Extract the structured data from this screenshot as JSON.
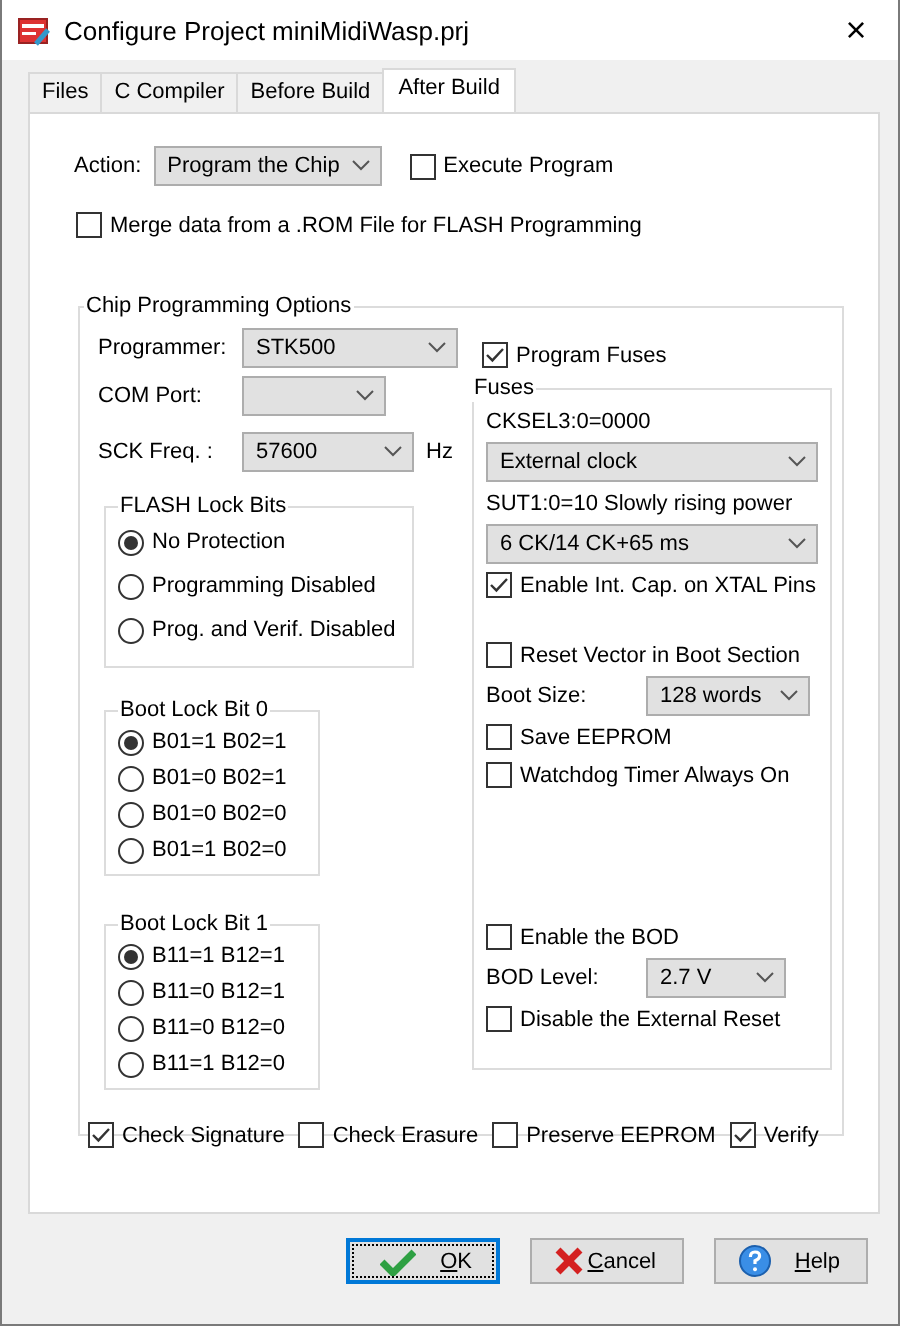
{
  "window": {
    "title": "Configure Project miniMidiWasp.prj",
    "close": "×"
  },
  "tabs": [
    {
      "label": "Files",
      "selected": false
    },
    {
      "label": "C Compiler",
      "selected": false
    },
    {
      "label": "Before Build",
      "selected": false
    },
    {
      "label": "After Build",
      "selected": true
    }
  ],
  "action": {
    "label": "Action:",
    "value": "Program the Chip"
  },
  "execute_program": {
    "label": "Execute Program",
    "checked": false
  },
  "merge_rom": {
    "label": "Merge data from a .ROM File for FLASH Programming",
    "checked": false
  },
  "chip_programming": {
    "title": "Chip Programming Options",
    "programmer": {
      "label": "Programmer:",
      "value": "STK500"
    },
    "com_port": {
      "label": "COM Port:"
    },
    "sck_freq": {
      "label": "SCK Freq. :",
      "value": "57600",
      "unit": "Hz"
    },
    "lock_groups": [
      {
        "title": "FLASH Lock Bits",
        "options": [
          {
            "label": "No Protection",
            "selected": true
          },
          {
            "label": "Programming Disabled",
            "selected": false
          },
          {
            "label": "Prog. and Verif. Disabled",
            "selected": false
          }
        ]
      },
      {
        "title": "Boot Lock Bit 0",
        "options": [
          {
            "label": "B01=1 B02=1",
            "selected": true
          },
          {
            "label": "B01=0 B02=1",
            "selected": false
          },
          {
            "label": "B01=0 B02=0",
            "selected": false
          },
          {
            "label": "B01=1 B02=0",
            "selected": false
          }
        ]
      },
      {
        "title": "Boot Lock Bit 1",
        "options": [
          {
            "label": "B11=1 B12=1",
            "selected": true
          },
          {
            "label": "B11=0 B12=1",
            "selected": false
          },
          {
            "label": "B11=0 B12=0",
            "selected": false
          },
          {
            "label": "B11=1 B12=0",
            "selected": false
          }
        ]
      }
    ],
    "program_fuses": {
      "label": "Program Fuses",
      "checked": true
    },
    "fuses": {
      "title": "Fuses",
      "sections": [
        {
          "items": [
            {
              "kind": "text",
              "label": "CKSEL3:0=0000"
            },
            {
              "kind": "combo",
              "value": "External clock"
            },
            {
              "kind": "text",
              "label": "SUT1:0=10 Slowly rising power"
            },
            {
              "kind": "combo",
              "value": "6 CK/14 CK+65 ms"
            },
            {
              "kind": "checkbox",
              "label": "Enable Int. Cap. on XTAL Pins",
              "checked": true
            }
          ]
        },
        {
          "items": [
            {
              "kind": "checkbox",
              "label": "Reset Vector in Boot Section",
              "checked": false
            },
            {
              "kind": "labeled_combo",
              "label": "Boot Size:",
              "value": "128 words"
            },
            {
              "kind": "checkbox",
              "label": "Save EEPROM",
              "checked": false
            },
            {
              "kind": "checkbox",
              "label": "Watchdog Timer Always On",
              "checked": false
            }
          ]
        },
        {
          "items": [
            {
              "kind": "checkbox",
              "label": "Enable the BOD",
              "checked": false
            },
            {
              "kind": "labeled_combo",
              "label": "BOD Level:",
              "value": "2.7 V"
            },
            {
              "kind": "checkbox",
              "label": "Disable the External Reset",
              "checked": false
            }
          ]
        }
      ]
    },
    "options": [
      {
        "label": "Check Signature",
        "checked": true
      },
      {
        "label": "Check Erasure",
        "checked": false
      },
      {
        "label": "Preserve EEPROM",
        "checked": false
      },
      {
        "label": "Verify",
        "checked": true
      }
    ]
  },
  "buttons": [
    {
      "kind": "ok",
      "label": "OK",
      "focused": true
    },
    {
      "kind": "cancel",
      "label": "Cancel",
      "focused": false
    },
    {
      "kind": "help",
      "label": "Help",
      "focused": false
    }
  ]
}
